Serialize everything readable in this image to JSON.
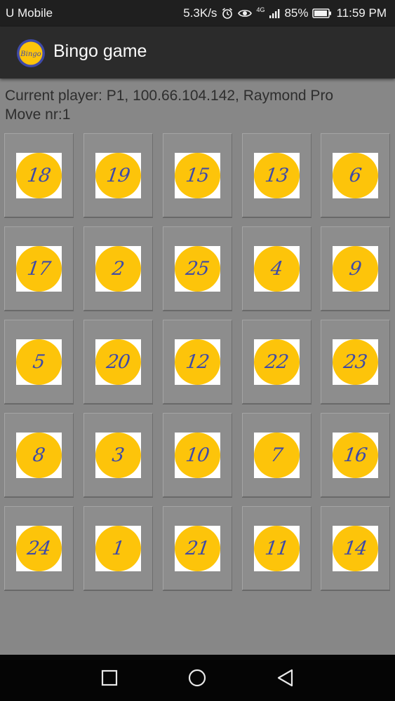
{
  "status": {
    "carrier": "U Mobile",
    "speed": "5.3K/s",
    "network": "4G",
    "battery": "85%",
    "time": "11:59 PM",
    "icons": [
      "alarm-icon",
      "eye-icon",
      "signal-icon",
      "battery-icon"
    ]
  },
  "app": {
    "title": "Bingo game",
    "logo_text": "Bingo"
  },
  "info": {
    "current_player": "Current player: P1, 100.66.104.142, Raymond Pro",
    "move": "Move nr:1"
  },
  "board": {
    "rows": [
      [
        "18",
        "19",
        "15",
        "13",
        "6"
      ],
      [
        "17",
        "2",
        "25",
        "4",
        "9"
      ],
      [
        "5",
        "20",
        "12",
        "22",
        "23"
      ],
      [
        "8",
        "3",
        "10",
        "7",
        "16"
      ],
      [
        "24",
        "1",
        "21",
        "11",
        "14"
      ]
    ]
  },
  "nav": {
    "icons": [
      "recents-icon",
      "home-icon",
      "back-icon"
    ]
  },
  "colors": {
    "ball": "#fdc40a",
    "number": "#3e4aa8",
    "background": "#878787"
  }
}
